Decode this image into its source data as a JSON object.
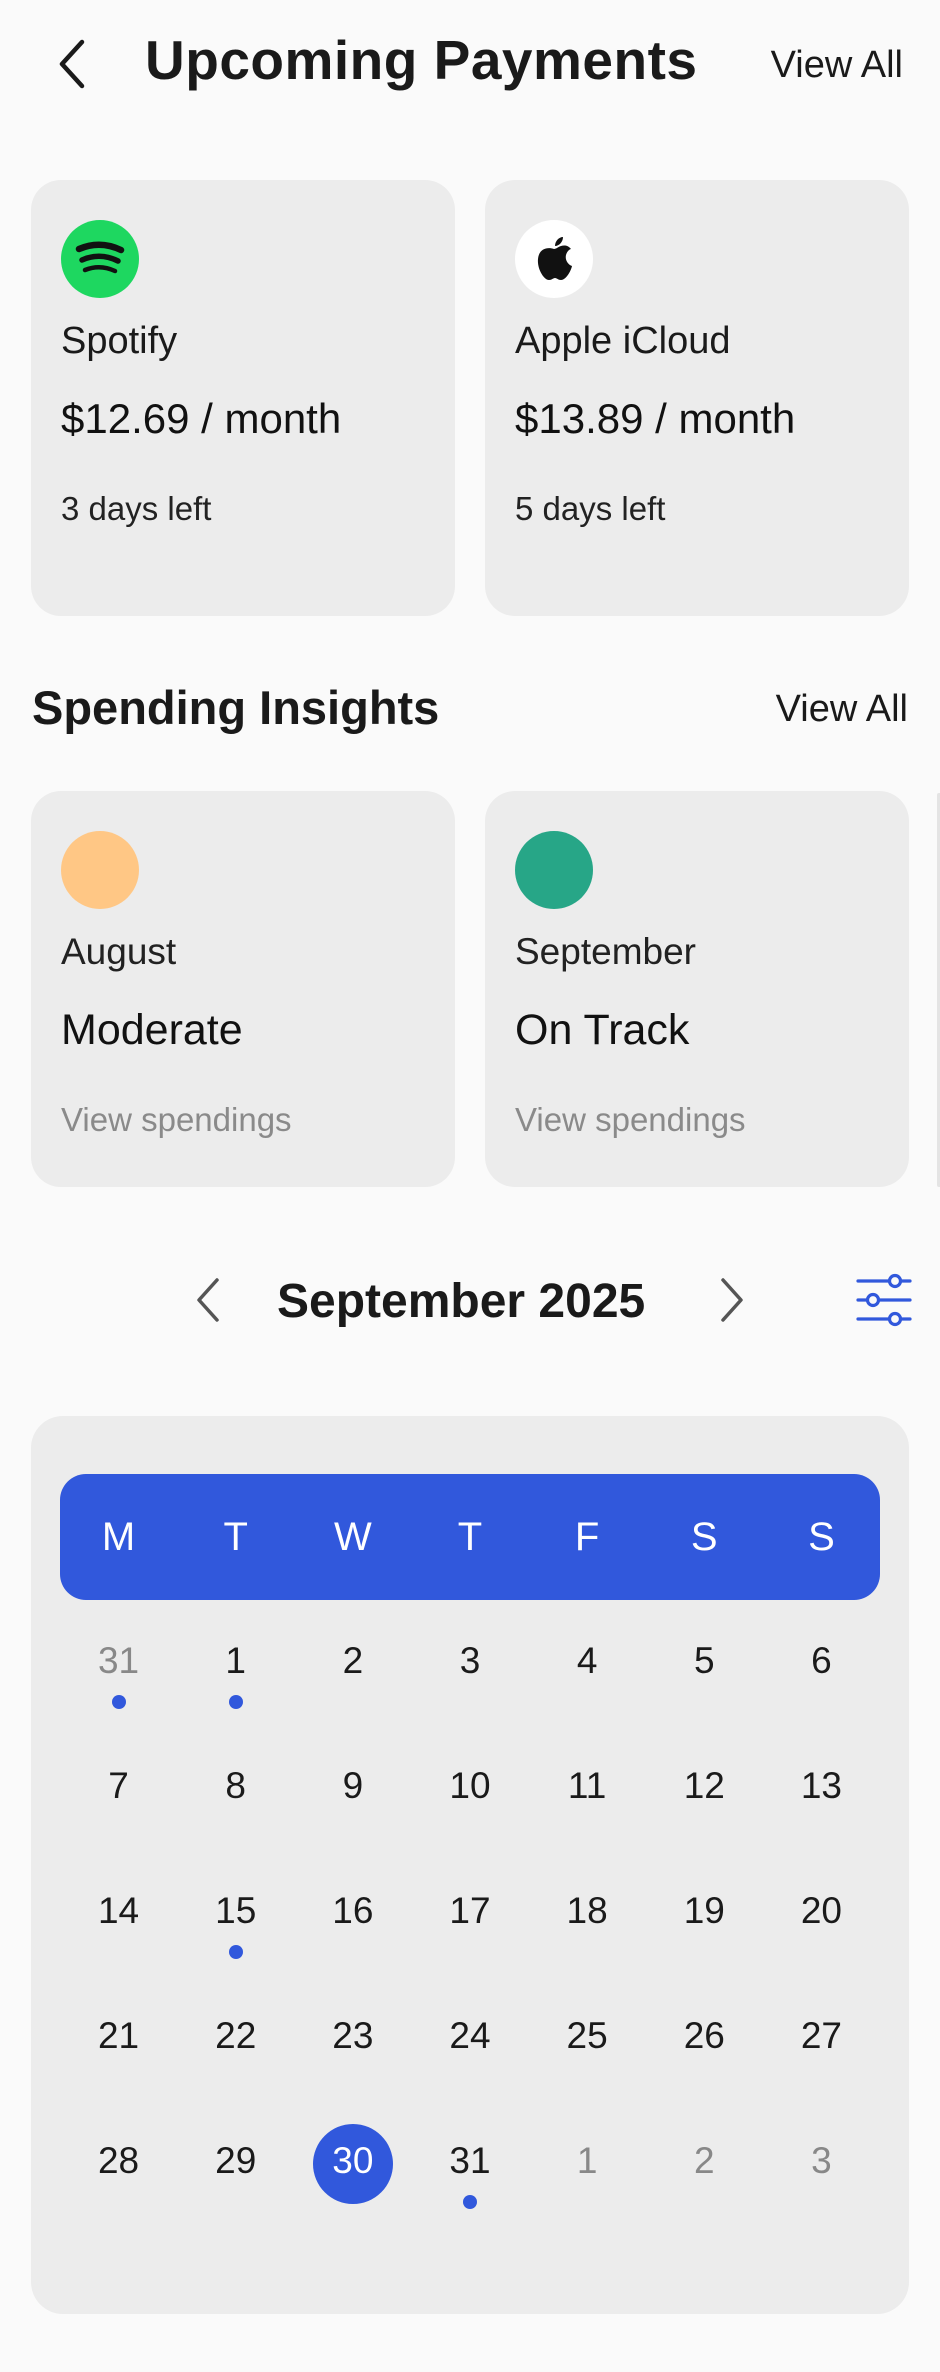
{
  "header": {
    "title": "Upcoming Payments",
    "view_all": "View All"
  },
  "payments": [
    {
      "name": "Spotify",
      "price": "$12.69 / month",
      "days_left": "3 days left",
      "icon": "spotify-icon",
      "color": "#1ed760"
    },
    {
      "name": "Apple iCloud",
      "price": "$13.89 / month",
      "days_left": "5 days left",
      "icon": "apple-icon",
      "color": "#ffffff"
    }
  ],
  "insights_section": {
    "title": "Spending Insights",
    "view_all": "View All"
  },
  "insights": [
    {
      "month": "August",
      "status": "Moderate",
      "link": "View spendings",
      "color": "#ffc785"
    },
    {
      "month": "September",
      "status": "On Track",
      "link": "View spendings",
      "color": "#27a687"
    }
  ],
  "calendar": {
    "month_title": "September 2025",
    "accent": "#3158dc",
    "weekdays": [
      "M",
      "T",
      "W",
      "T",
      "F",
      "S",
      "S"
    ],
    "weeks": [
      [
        {
          "d": "31",
          "muted": true,
          "dot": true
        },
        {
          "d": "1",
          "dot": true
        },
        {
          "d": "2"
        },
        {
          "d": "3"
        },
        {
          "d": "4"
        },
        {
          "d": "5"
        },
        {
          "d": "6"
        }
      ],
      [
        {
          "d": "7"
        },
        {
          "d": "8"
        },
        {
          "d": "9"
        },
        {
          "d": "10"
        },
        {
          "d": "11"
        },
        {
          "d": "12"
        },
        {
          "d": "13"
        }
      ],
      [
        {
          "d": "14"
        },
        {
          "d": "15",
          "dot": true
        },
        {
          "d": "16"
        },
        {
          "d": "17"
        },
        {
          "d": "18"
        },
        {
          "d": "19"
        },
        {
          "d": "20"
        }
      ],
      [
        {
          "d": "21"
        },
        {
          "d": "22"
        },
        {
          "d": "23"
        },
        {
          "d": "24"
        },
        {
          "d": "25"
        },
        {
          "d": "26"
        },
        {
          "d": "27"
        }
      ],
      [
        {
          "d": "28"
        },
        {
          "d": "29"
        },
        {
          "d": "30",
          "selected": true
        },
        {
          "d": "31",
          "dot": true
        },
        {
          "d": "1",
          "muted": true
        },
        {
          "d": "2",
          "muted": true
        },
        {
          "d": "3",
          "muted": true
        }
      ]
    ]
  }
}
